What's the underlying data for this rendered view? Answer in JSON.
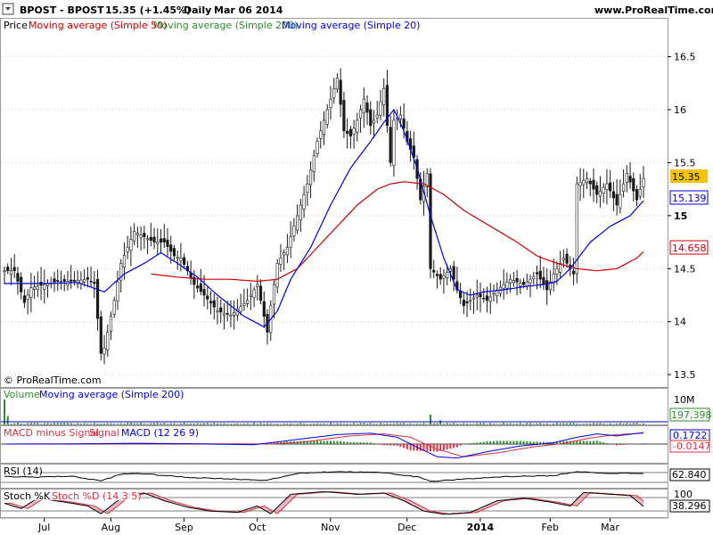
{
  "header": {
    "ticker": "BPOST - BPOST",
    "quote": "15.35 (+1.45%)",
    "period": "Daily",
    "date": "Mar 06 2014",
    "site": "www.ProRealTime.com"
  },
  "watermark": "© ProRealTime.com",
  "colors": {
    "price_bars": "#1a1a1a",
    "ma50": "#cc0000",
    "ma200": "#2e8b2e",
    "ma20": "#0000ee",
    "volume": "#2e8b2e",
    "macd_hist_pos": "#2e8b2e",
    "macd_hist_neg": "#dd3344",
    "grid": "#c8c8c8",
    "last_badge": "#f5c400"
  },
  "chart_data": [
    {
      "type": "bar",
      "name": "price",
      "legend": [
        "Price",
        "Moving average (Simple 50)",
        "Moving average (Simple 200)",
        "Moving average (Simple 20)"
      ],
      "ylim": [
        13.4,
        16.85
      ],
      "yticks": [
        "16.5",
        "16",
        "15.5",
        "15",
        "14.5",
        "14",
        "13.5"
      ],
      "ytick_values": [
        16.5,
        16.0,
        15.5,
        15.0,
        14.5,
        14.0,
        13.5
      ],
      "x_labels": [
        "Jul",
        "Aug",
        "Sep",
        "Oct",
        "Nov",
        "Dec",
        "2014",
        "Feb",
        "Mar"
      ],
      "x_label_days": [
        5,
        25,
        47,
        69,
        91,
        114,
        136,
        157,
        175
      ],
      "last_values": {
        "price": "15.35",
        "ma20": "15.139",
        "ma50": "14.658"
      },
      "anchors": {
        "close": [
          [
            0,
            14.48
          ],
          [
            3,
            14.48
          ],
          [
            6,
            14.18
          ],
          [
            8,
            14.32
          ],
          [
            12,
            14.35
          ],
          [
            16,
            14.38
          ],
          [
            20,
            14.38
          ],
          [
            25,
            14.4
          ],
          [
            27,
            14.36
          ],
          [
            29,
            13.7
          ],
          [
            30,
            13.75
          ],
          [
            33,
            14.2
          ],
          [
            35,
            14.55
          ],
          [
            39,
            14.85
          ],
          [
            45,
            14.75
          ],
          [
            48,
            14.75
          ],
          [
            51,
            14.62
          ],
          [
            53,
            14.6
          ],
          [
            55,
            14.48
          ],
          [
            57,
            14.35
          ],
          [
            60,
            14.25
          ],
          [
            64,
            14.1
          ],
          [
            68,
            14.06
          ],
          [
            73,
            14.2
          ],
          [
            76,
            14.35
          ],
          [
            79,
            13.9
          ],
          [
            80,
            14.15
          ],
          [
            82,
            14.55
          ],
          [
            85,
            14.7
          ],
          [
            88,
            15.0
          ],
          [
            91,
            15.3
          ],
          [
            94,
            15.7
          ],
          [
            97,
            16.0
          ],
          [
            100,
            16.3
          ],
          [
            102,
            15.8
          ],
          [
            104,
            15.75
          ],
          [
            106,
            15.9
          ],
          [
            108,
            16.1
          ],
          [
            110,
            15.85
          ],
          [
            112,
            15.95
          ],
          [
            114,
            16.2
          ],
          [
            116,
            15.5
          ],
          [
            117,
            15.9
          ],
          [
            119,
            15.95
          ],
          [
            121,
            15.7
          ],
          [
            123,
            15.55
          ],
          [
            125,
            15.15
          ],
          [
            127,
            15.4
          ],
          [
            128,
            14.5
          ],
          [
            131,
            14.4
          ],
          [
            134,
            14.5
          ],
          [
            136,
            14.3
          ],
          [
            138,
            14.15
          ],
          [
            142,
            14.25
          ],
          [
            145,
            14.2
          ],
          [
            148,
            14.3
          ],
          [
            152,
            14.4
          ],
          [
            156,
            14.35
          ],
          [
            158,
            14.4
          ],
          [
            160,
            14.45
          ],
          [
            163,
            14.3
          ],
          [
            165,
            14.45
          ],
          [
            167,
            14.55
          ],
          [
            168,
            14.6
          ],
          [
            171,
            14.45
          ],
          [
            172,
            15.3
          ],
          [
            175,
            15.35
          ],
          [
            178,
            15.2
          ],
          [
            181,
            15.3
          ],
          [
            184,
            15.1
          ],
          [
            187,
            15.4
          ],
          [
            190,
            15.15
          ],
          [
            192,
            15.35
          ]
        ],
        "ma20": [
          [
            0,
            14.36
          ],
          [
            14,
            14.36
          ],
          [
            22,
            14.37
          ],
          [
            30,
            14.28
          ],
          [
            36,
            14.45
          ],
          [
            42,
            14.55
          ],
          [
            47,
            14.65
          ],
          [
            52,
            14.55
          ],
          [
            58,
            14.42
          ],
          [
            64,
            14.25
          ],
          [
            72,
            14.05
          ],
          [
            78,
            13.95
          ],
          [
            82,
            14.1
          ],
          [
            86,
            14.4
          ],
          [
            92,
            14.7
          ],
          [
            98,
            15.1
          ],
          [
            104,
            15.45
          ],
          [
            110,
            15.7
          ],
          [
            114,
            15.88
          ],
          [
            117,
            16.0
          ],
          [
            120,
            15.8
          ],
          [
            124,
            15.45
          ],
          [
            128,
            15.0
          ],
          [
            132,
            14.6
          ],
          [
            136,
            14.3
          ],
          [
            140,
            14.25
          ],
          [
            144,
            14.28
          ],
          [
            150,
            14.3
          ],
          [
            156,
            14.33
          ],
          [
            162,
            14.35
          ],
          [
            166,
            14.38
          ],
          [
            170,
            14.5
          ],
          [
            176,
            14.75
          ],
          [
            182,
            14.9
          ],
          [
            188,
            15.0
          ],
          [
            192,
            15.14
          ]
        ],
        "ma50": [
          [
            44,
            14.45
          ],
          [
            52,
            14.42
          ],
          [
            60,
            14.4
          ],
          [
            68,
            14.4
          ],
          [
            76,
            14.38
          ],
          [
            82,
            14.4
          ],
          [
            88,
            14.5
          ],
          [
            94,
            14.7
          ],
          [
            100,
            14.9
          ],
          [
            106,
            15.1
          ],
          [
            112,
            15.25
          ],
          [
            116,
            15.3
          ],
          [
            120,
            15.32
          ],
          [
            126,
            15.3
          ],
          [
            132,
            15.2
          ],
          [
            138,
            15.05
          ],
          [
            146,
            14.9
          ],
          [
            154,
            14.75
          ],
          [
            160,
            14.62
          ],
          [
            166,
            14.55
          ],
          [
            172,
            14.5
          ],
          [
            178,
            14.48
          ],
          [
            184,
            14.5
          ],
          [
            190,
            14.6
          ],
          [
            192,
            14.66
          ]
        ]
      }
    },
    {
      "type": "bar",
      "name": "volume",
      "legend": [
        "Volume",
        "Moving average (Simple 200)"
      ],
      "ytick": "10M",
      "last_value": "197,398",
      "ylim": [
        0,
        12000000
      ]
    },
    {
      "type": "area",
      "name": "macd",
      "legend": [
        "MACD minus Signal",
        "Signal",
        "MACD (12 26 9)"
      ],
      "values_shown": [
        "0.1722",
        "-0.0147"
      ],
      "ylim": [
        -0.28,
        0.25
      ]
    },
    {
      "type": "line",
      "name": "rsi",
      "legend": [
        "RSI (14)"
      ],
      "last_value": "62.840",
      "ylim": [
        0,
        100
      ]
    },
    {
      "type": "line",
      "name": "stochastic",
      "legend": [
        "Stoch %K",
        "Stoch %D (14 3 5)"
      ],
      "ytick": "100",
      "last_value": "38.296",
      "ylim": [
        0,
        100
      ]
    }
  ]
}
